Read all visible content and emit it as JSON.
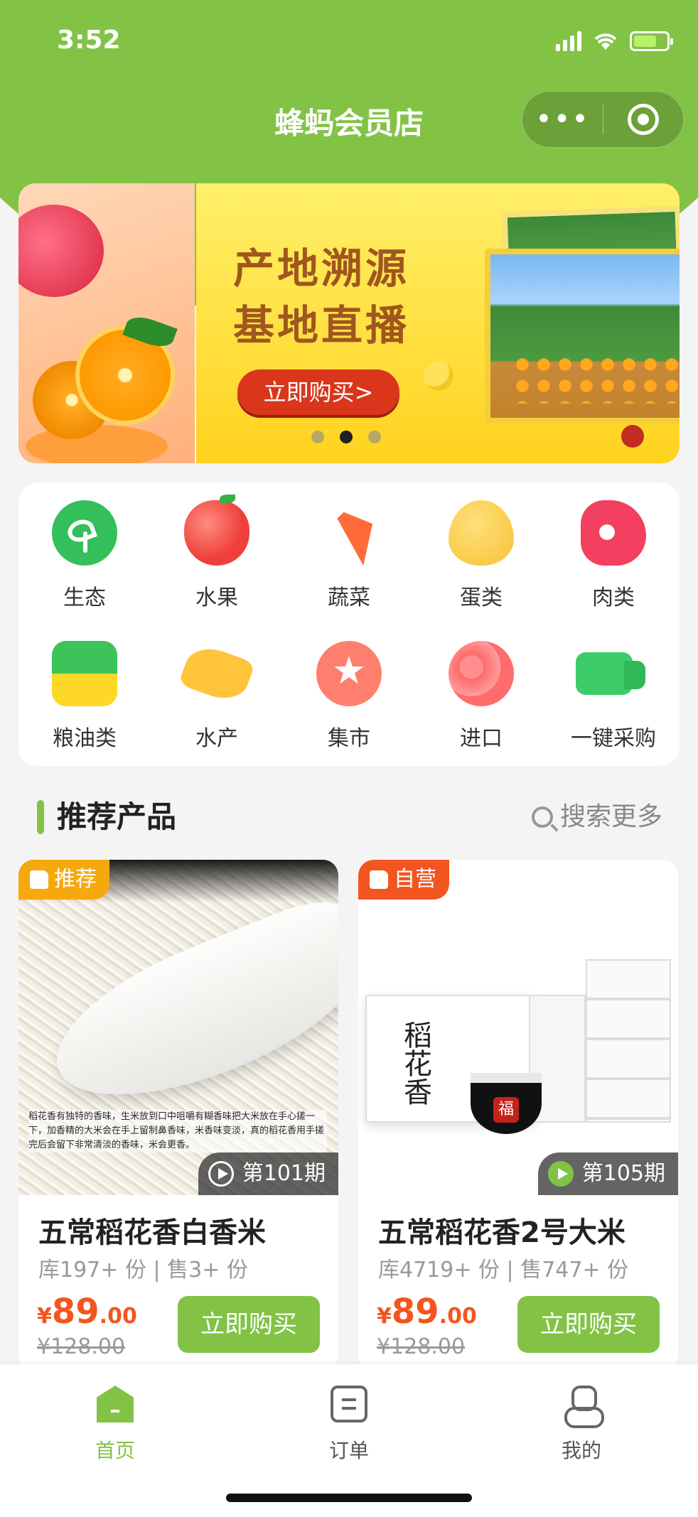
{
  "status_bar": {
    "time": "3:52"
  },
  "nav": {
    "title": "蜂蚂会员店",
    "more_icon": "more-dots-icon",
    "close_icon": "target-circle-icon"
  },
  "banner": {
    "title_line1": "产地溯源",
    "title_line2": "基地直播",
    "cta": "立即购买>",
    "active_slide": 2,
    "slide_count": 3
  },
  "categories": [
    {
      "label": "生态",
      "icon": "sprout-icon"
    },
    {
      "label": "水果",
      "icon": "apple-icon"
    },
    {
      "label": "蔬菜",
      "icon": "carrot-icon"
    },
    {
      "label": "蛋类",
      "icon": "egg-icon"
    },
    {
      "label": "肉类",
      "icon": "meat-icon"
    },
    {
      "label": "粮油类",
      "icon": "oil-bottle-icon"
    },
    {
      "label": "水产",
      "icon": "fish-icon"
    },
    {
      "label": "集市",
      "icon": "market-star-icon"
    },
    {
      "label": "进口",
      "icon": "globe-icon"
    },
    {
      "label": "一键采购",
      "icon": "truck-icon"
    }
  ],
  "section": {
    "title": "推荐产品",
    "search_more": "搜索更多"
  },
  "products": [
    {
      "tag": "推荐",
      "period": "第101期",
      "name": "五常稻花香白香米",
      "stock": "库197+ 份 | 售3+ 份",
      "price_symbol": "¥",
      "price_int": "89",
      "price_dec": ".00",
      "original_price": "¥128.00",
      "buy_label": "立即购买",
      "caption": "稻花香有独特的香味，生米放到口中咀嚼有糊香味把大米放在手心搓一下，加香精的大米会在手上留制鼻香味，米香味变淡，真的稻花香用手搓完后会留下非常清淡的香味，米会更香。"
    },
    {
      "tag": "自营",
      "period": "第105期",
      "name": "五常稻花香2号大米",
      "stock": "库4719+ 份 | 售747+ 份",
      "price_symbol": "¥",
      "price_int": "89",
      "price_dec": ".00",
      "original_price": "¥128.00",
      "buy_label": "立即购买",
      "box_text": "稻花香"
    }
  ],
  "tabbar": [
    {
      "label": "首页",
      "icon": "home-icon",
      "active": true
    },
    {
      "label": "订单",
      "icon": "order-icon",
      "active": false
    },
    {
      "label": "我的",
      "icon": "profile-icon",
      "active": false
    }
  ],
  "colors": {
    "brand_green": "#82c346",
    "price_red": "#f2561e",
    "tag_yellow": "#f6a90c",
    "tag_red": "#f2561e"
  }
}
